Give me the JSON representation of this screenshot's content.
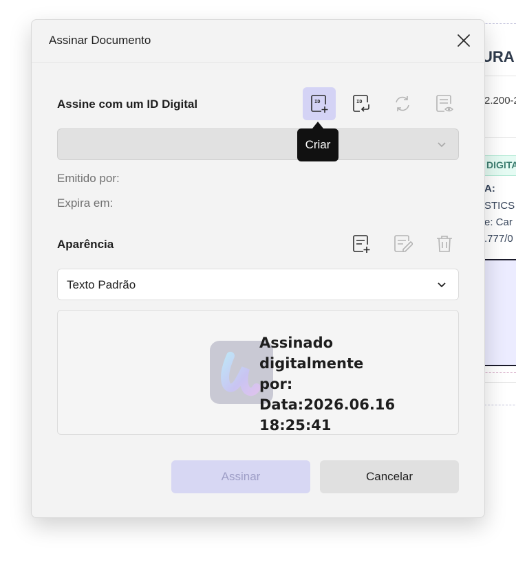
{
  "background_document": {
    "title_fragment": "URA I",
    "number_fragment": "2.200-2",
    "badge_fragment": "DIGITA",
    "lines": [
      "A:",
      "STICS",
      "e: Car",
      ".777/0"
    ]
  },
  "dialog": {
    "title": "Assinar Documento",
    "digital_id": {
      "label": "Assine com um ID Digital",
      "select_value": "",
      "tooltip": "Criar",
      "issued_by_label": "Emitido por:",
      "expires_label": "Expira em:",
      "icons": [
        "id-create-icon",
        "id-import-icon",
        "refresh-icon",
        "id-view-icon"
      ]
    },
    "appearance": {
      "label": "Aparência",
      "select_value": "Texto Padrão",
      "icons": [
        "appearance-create-icon",
        "appearance-edit-icon",
        "delete-icon"
      ]
    },
    "preview": {
      "lines": [
        "Assinado digitalmente",
        "por:",
        "Data:2026.06.16",
        "18:25:41"
      ]
    },
    "buttons": {
      "sign": "Assinar",
      "cancel": "Cancelar"
    }
  },
  "colors": {
    "accent_active_bg": "#d4d3f5",
    "sign_disabled_bg": "#d7d7f3",
    "sign_disabled_text": "#9d9dc6",
    "tooltip_bg": "#111111"
  }
}
